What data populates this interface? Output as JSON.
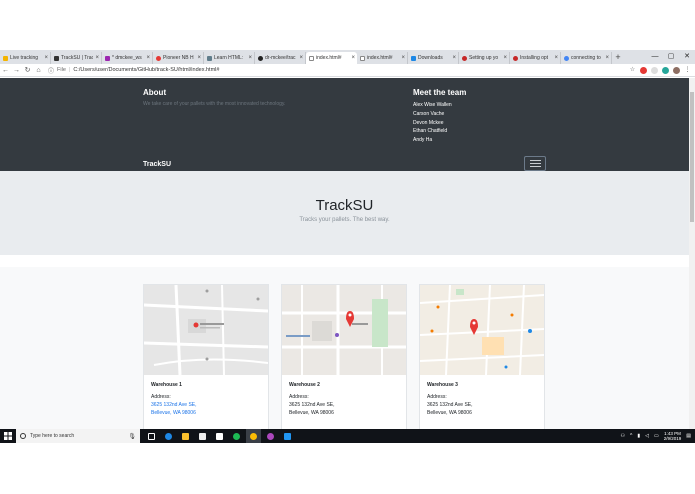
{
  "browser": {
    "tabs": [
      {
        "title": "Live tracking",
        "color": "#f4b400"
      },
      {
        "title": "TrackSU | Trac",
        "color": "#333333"
      },
      {
        "title": "* dmckee_ws",
        "color": "#9c27b0"
      },
      {
        "title": "Pioneer NB H",
        "color": "#e53935"
      },
      {
        "title": "Learn HTML:",
        "color": "#607d8b"
      },
      {
        "title": "dr-mckee/trac",
        "color": "#222222"
      },
      {
        "title": "index.html#",
        "color": "#9e9e9e",
        "active": true
      },
      {
        "title": "index.html#",
        "color": "#9e9e9e"
      },
      {
        "title": "Downloads",
        "color": "#1e88e5"
      },
      {
        "title": "Setting up yo",
        "color": "#c62828"
      },
      {
        "title": "Installing opt",
        "color": "#c62828"
      },
      {
        "title": "connecting to",
        "color": "#4285f4"
      }
    ],
    "new_tab": "+",
    "window_controls": {
      "minimize": "—",
      "maximize": "▢",
      "close": "✕"
    },
    "address": {
      "scheme_label": "File",
      "url": "C:/Users/user/Documents/GitHub/track-SU/html/index.html#"
    }
  },
  "page": {
    "about": {
      "title": "About",
      "text": "We take care of your pallets with the most innovated technology."
    },
    "team": {
      "title": "Meet the team",
      "members": [
        "Alex Wise Wallen",
        "Carson Vache",
        "Devon Mckee",
        "Ethan Chatfield",
        "Andy Ha"
      ]
    },
    "brand": "TrackSU",
    "hero": {
      "title": "TrackSU",
      "subtitle": "Tracks your pallets. The best way."
    },
    "warehouses": [
      {
        "name": "Warehouse 1",
        "address_label": "Address:",
        "line1": "3625 132nd Ave SE,",
        "line2": "Bellevue, WA 98006",
        "link": true
      },
      {
        "name": "Warehouse 2",
        "address_label": "Address:",
        "line1": "3625 132nd Ave SE,",
        "line2": "Bellevue, WA 98006",
        "link": false
      },
      {
        "name": "Warehouse 3",
        "address_label": "Address:",
        "line1": "3625 132nd Ave SE,",
        "line2": "Bellevue, WA 98006",
        "link": false
      }
    ]
  },
  "taskbar": {
    "search_placeholder": "Type here to search",
    "time": "1:43 PM",
    "date": "2/9/2019"
  }
}
